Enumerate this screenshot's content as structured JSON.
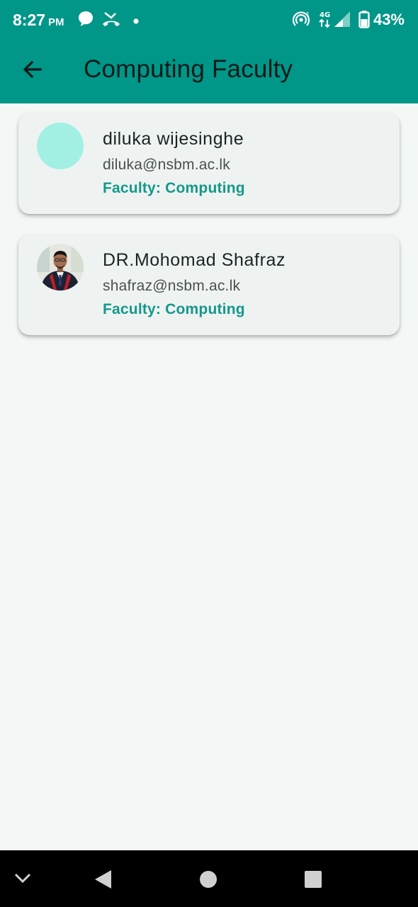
{
  "status_bar": {
    "time": "8:27",
    "ampm": "PM",
    "network": "4G",
    "battery": "43%",
    "icons": [
      "chat-bubble-icon",
      "missed-call-icon",
      "dot-icon",
      "hotspot-icon",
      "4g-icon",
      "signal-icon",
      "battery-icon"
    ]
  },
  "app_bar": {
    "title": "Computing Faculty",
    "back_icon": "arrow-back-icon"
  },
  "members": [
    {
      "name": "diluka wijesinghe",
      "email": "diluka@nsbm.ac.lk",
      "faculty": "Faculty: Computing",
      "avatar": "blank"
    },
    {
      "name": "DR.Mohomad Shafraz",
      "email": "shafraz@nsbm.ac.lk",
      "faculty": "Faculty: Computing",
      "avatar": "photo"
    }
  ],
  "nav_bar": {
    "icons": [
      "chevron-down-icon",
      "back-triangle-icon",
      "home-circle-icon",
      "recents-square-icon"
    ]
  },
  "colors": {
    "primary": "#009688",
    "accent_text": "#14988a",
    "background": "#f3f8f7",
    "card": "#eef3f2",
    "avatar_placeholder": "#a2f0e4"
  }
}
